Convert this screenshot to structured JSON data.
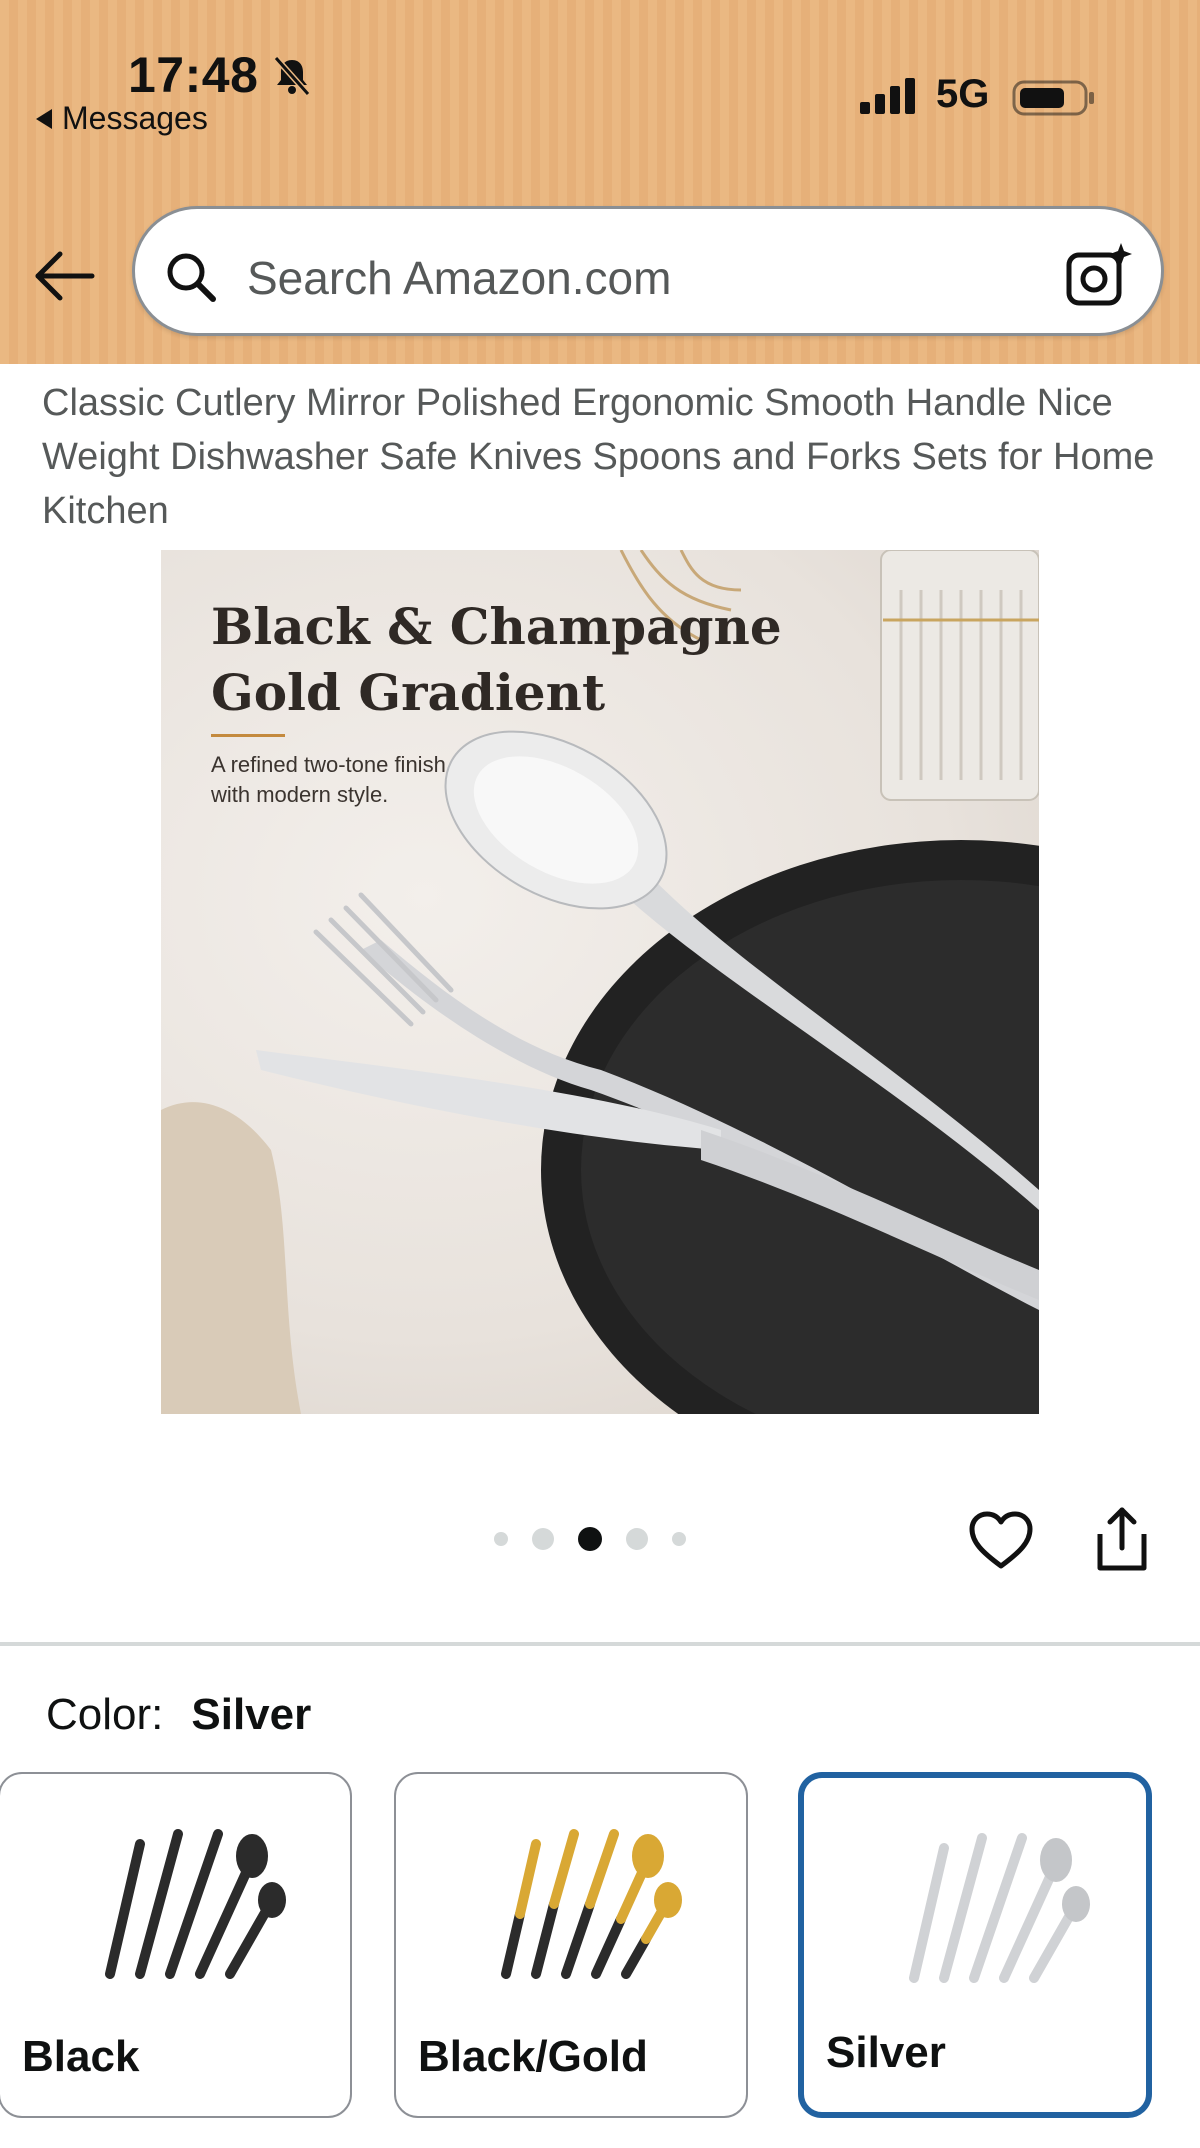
{
  "status_bar": {
    "time": "17:48",
    "back_app": "Messages",
    "network": "5G",
    "icons": [
      "bell-slash-icon",
      "signal-icon",
      "battery-icon"
    ]
  },
  "search": {
    "placeholder": "Search Amazon.com",
    "icons": [
      "back-arrow-icon",
      "search-icon",
      "camera-lens-icon"
    ]
  },
  "product": {
    "title": "Classic Cutlery Mirror Polished Ergonomic Smooth Handle Nice Weight Dishwasher Safe Knives Spoons and Forks Sets for Home Kitchen",
    "image": {
      "heading_line1": "Black & Champagne",
      "heading_line2": "Gold Gradient",
      "subtext_line1": "A refined two-tone finish",
      "subtext_line2": "with modern style."
    },
    "carousel": {
      "total": 5,
      "active_index": 3
    },
    "actions": [
      "heart-icon",
      "share-icon"
    ]
  },
  "color": {
    "label": "Color:",
    "selected": "Silver",
    "options": [
      {
        "label": "Black",
        "selected": false
      },
      {
        "label": "Black/Gold",
        "selected": false
      },
      {
        "label": "Silver",
        "selected": true
      }
    ]
  },
  "colors": {
    "header_bg": "#eab882",
    "selected_border": "#2162a1",
    "text_secondary": "#565959"
  }
}
